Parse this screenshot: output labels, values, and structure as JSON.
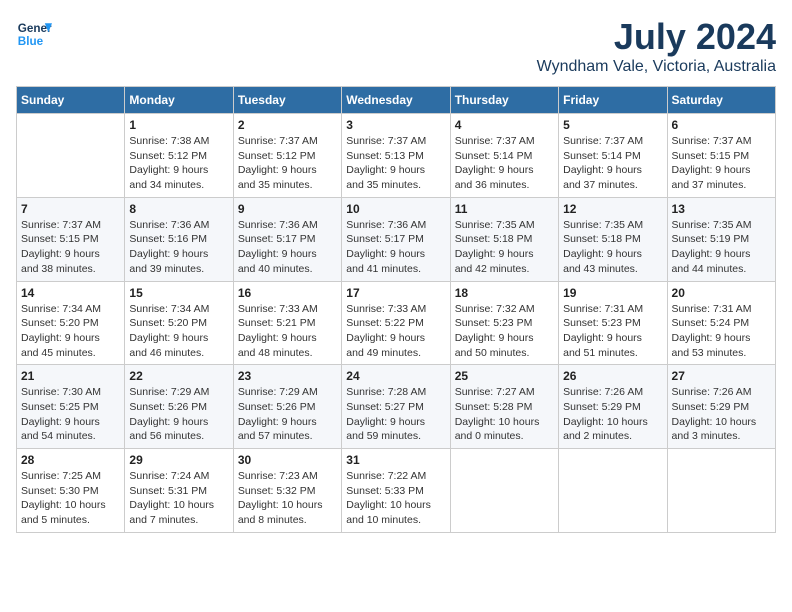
{
  "logo": {
    "line1": "General",
    "line2": "Blue"
  },
  "title": "July 2024",
  "location": "Wyndham Vale, Victoria, Australia",
  "weekdays": [
    "Sunday",
    "Monday",
    "Tuesday",
    "Wednesday",
    "Thursday",
    "Friday",
    "Saturday"
  ],
  "weeks": [
    [
      {
        "day": "",
        "detail": ""
      },
      {
        "day": "1",
        "detail": "Sunrise: 7:38 AM\nSunset: 5:12 PM\nDaylight: 9 hours\nand 34 minutes."
      },
      {
        "day": "2",
        "detail": "Sunrise: 7:37 AM\nSunset: 5:12 PM\nDaylight: 9 hours\nand 35 minutes."
      },
      {
        "day": "3",
        "detail": "Sunrise: 7:37 AM\nSunset: 5:13 PM\nDaylight: 9 hours\nand 35 minutes."
      },
      {
        "day": "4",
        "detail": "Sunrise: 7:37 AM\nSunset: 5:14 PM\nDaylight: 9 hours\nand 36 minutes."
      },
      {
        "day": "5",
        "detail": "Sunrise: 7:37 AM\nSunset: 5:14 PM\nDaylight: 9 hours\nand 37 minutes."
      },
      {
        "day": "6",
        "detail": "Sunrise: 7:37 AM\nSunset: 5:15 PM\nDaylight: 9 hours\nand 37 minutes."
      }
    ],
    [
      {
        "day": "7",
        "detail": "Sunrise: 7:37 AM\nSunset: 5:15 PM\nDaylight: 9 hours\nand 38 minutes."
      },
      {
        "day": "8",
        "detail": "Sunrise: 7:36 AM\nSunset: 5:16 PM\nDaylight: 9 hours\nand 39 minutes."
      },
      {
        "day": "9",
        "detail": "Sunrise: 7:36 AM\nSunset: 5:17 PM\nDaylight: 9 hours\nand 40 minutes."
      },
      {
        "day": "10",
        "detail": "Sunrise: 7:36 AM\nSunset: 5:17 PM\nDaylight: 9 hours\nand 41 minutes."
      },
      {
        "day": "11",
        "detail": "Sunrise: 7:35 AM\nSunset: 5:18 PM\nDaylight: 9 hours\nand 42 minutes."
      },
      {
        "day": "12",
        "detail": "Sunrise: 7:35 AM\nSunset: 5:18 PM\nDaylight: 9 hours\nand 43 minutes."
      },
      {
        "day": "13",
        "detail": "Sunrise: 7:35 AM\nSunset: 5:19 PM\nDaylight: 9 hours\nand 44 minutes."
      }
    ],
    [
      {
        "day": "14",
        "detail": "Sunrise: 7:34 AM\nSunset: 5:20 PM\nDaylight: 9 hours\nand 45 minutes."
      },
      {
        "day": "15",
        "detail": "Sunrise: 7:34 AM\nSunset: 5:20 PM\nDaylight: 9 hours\nand 46 minutes."
      },
      {
        "day": "16",
        "detail": "Sunrise: 7:33 AM\nSunset: 5:21 PM\nDaylight: 9 hours\nand 48 minutes."
      },
      {
        "day": "17",
        "detail": "Sunrise: 7:33 AM\nSunset: 5:22 PM\nDaylight: 9 hours\nand 49 minutes."
      },
      {
        "day": "18",
        "detail": "Sunrise: 7:32 AM\nSunset: 5:23 PM\nDaylight: 9 hours\nand 50 minutes."
      },
      {
        "day": "19",
        "detail": "Sunrise: 7:31 AM\nSunset: 5:23 PM\nDaylight: 9 hours\nand 51 minutes."
      },
      {
        "day": "20",
        "detail": "Sunrise: 7:31 AM\nSunset: 5:24 PM\nDaylight: 9 hours\nand 53 minutes."
      }
    ],
    [
      {
        "day": "21",
        "detail": "Sunrise: 7:30 AM\nSunset: 5:25 PM\nDaylight: 9 hours\nand 54 minutes."
      },
      {
        "day": "22",
        "detail": "Sunrise: 7:29 AM\nSunset: 5:26 PM\nDaylight: 9 hours\nand 56 minutes."
      },
      {
        "day": "23",
        "detail": "Sunrise: 7:29 AM\nSunset: 5:26 PM\nDaylight: 9 hours\nand 57 minutes."
      },
      {
        "day": "24",
        "detail": "Sunrise: 7:28 AM\nSunset: 5:27 PM\nDaylight: 9 hours\nand 59 minutes."
      },
      {
        "day": "25",
        "detail": "Sunrise: 7:27 AM\nSunset: 5:28 PM\nDaylight: 10 hours\nand 0 minutes."
      },
      {
        "day": "26",
        "detail": "Sunrise: 7:26 AM\nSunset: 5:29 PM\nDaylight: 10 hours\nand 2 minutes."
      },
      {
        "day": "27",
        "detail": "Sunrise: 7:26 AM\nSunset: 5:29 PM\nDaylight: 10 hours\nand 3 minutes."
      }
    ],
    [
      {
        "day": "28",
        "detail": "Sunrise: 7:25 AM\nSunset: 5:30 PM\nDaylight: 10 hours\nand 5 minutes."
      },
      {
        "day": "29",
        "detail": "Sunrise: 7:24 AM\nSunset: 5:31 PM\nDaylight: 10 hours\nand 7 minutes."
      },
      {
        "day": "30",
        "detail": "Sunrise: 7:23 AM\nSunset: 5:32 PM\nDaylight: 10 hours\nand 8 minutes."
      },
      {
        "day": "31",
        "detail": "Sunrise: 7:22 AM\nSunset: 5:33 PM\nDaylight: 10 hours\nand 10 minutes."
      },
      {
        "day": "",
        "detail": ""
      },
      {
        "day": "",
        "detail": ""
      },
      {
        "day": "",
        "detail": ""
      }
    ]
  ]
}
